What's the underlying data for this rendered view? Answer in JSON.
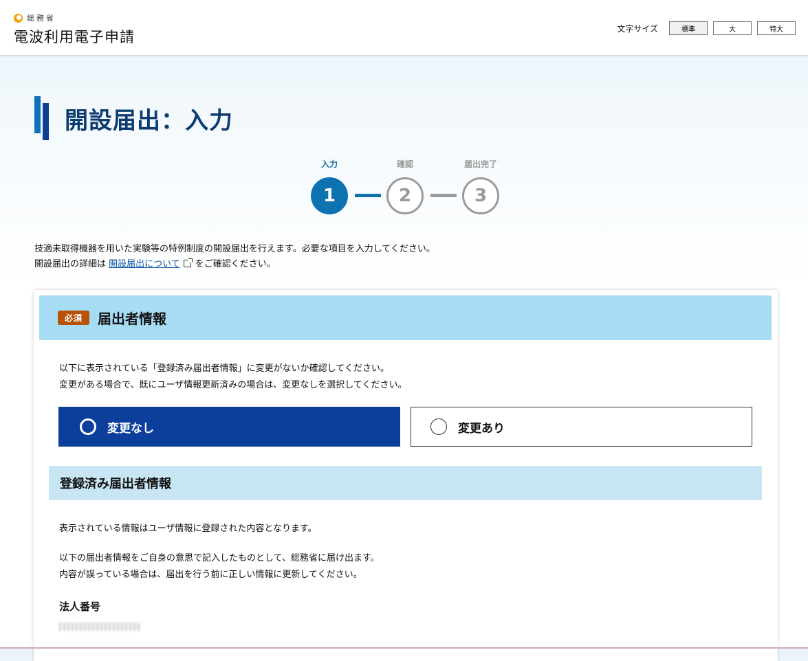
{
  "header": {
    "ministry": "総務省",
    "site_title": "電波利用電子申請",
    "font_size_label": "文字サイズ",
    "font_size_options": [
      "標準",
      "大",
      "特大"
    ]
  },
  "page_title": "開設届出：入力",
  "stepper": {
    "steps": [
      {
        "label": "入力",
        "number": "1",
        "state": "current"
      },
      {
        "label": "確認",
        "number": "2",
        "state": "pending"
      },
      {
        "label": "届出完了",
        "number": "3",
        "state": "pending"
      }
    ]
  },
  "intro": {
    "line1": "技適未取得機器を用いた実験等の特例制度の開設届出を行えます。必要な項目を入力してください。",
    "line2_prefix": "開設届出の詳細は",
    "line2_link": "開設届出について",
    "line2_suffix": "をご確認ください。"
  },
  "section": {
    "badge": "必須",
    "title": "届出者情報",
    "desc1": "以下に表示されている「登録済み届出者情報」に変更がないか確認してください。",
    "desc2": "変更がある場合で、既にユーザ情報更新済みの場合は、変更なしを選択してください。",
    "options": [
      {
        "label": "変更なし",
        "selected": true
      },
      {
        "label": "変更あり",
        "selected": false
      }
    ]
  },
  "registered": {
    "title": "登録済み届出者情報",
    "text1": "表示されている情報はユーザ情報に登録された内容となります。",
    "text2": "以下の届出者情報をご自身の意思で記入したものとして、総務省に届け出ます。",
    "text3": "内容が誤っている場合は、届出を行う前に正しい情報に更新してください。",
    "field_label": "法人番号"
  },
  "colors": {
    "primary": "#0c3f9b",
    "step_current": "#0d72b0",
    "title_text": "#0d3c70",
    "badge": "#b85207",
    "section_bg": "#a7dcf5",
    "subsection_bg": "#c7e5f2"
  }
}
